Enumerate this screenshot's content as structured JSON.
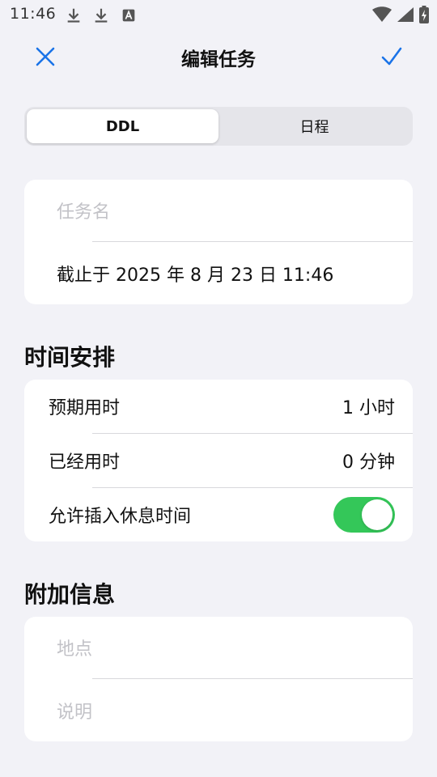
{
  "status_bar": {
    "time": "11:46",
    "icons": [
      "download-icon",
      "download-icon",
      "keyboard-a-icon",
      "wifi-icon",
      "signal-icon",
      "battery-charging-icon"
    ]
  },
  "nav": {
    "close_icon": "close-icon",
    "title": "编辑任务",
    "done_icon": "checkmark-icon"
  },
  "segmented": {
    "options": [
      "DDL",
      "日程"
    ],
    "selected": "DDL"
  },
  "task_card": {
    "name_placeholder": "任务名",
    "deadline": "截止于 2025 年 8 月 23 日 11:46"
  },
  "time_section": {
    "header": "时间安排",
    "rows": [
      {
        "label": "预期用时",
        "value": "1 小时"
      },
      {
        "label": "已经用时",
        "value": "0 分钟"
      },
      {
        "label": "允许插入休息时间",
        "toggle_on": true
      }
    ]
  },
  "extra_section": {
    "header": "附加信息",
    "location_placeholder": "地点",
    "description_placeholder": "说明"
  },
  "colors": {
    "accent": "#1a73e8",
    "toggle_on": "#34c759",
    "background": "#f2f2f7",
    "placeholder": "#c2c2c7"
  }
}
